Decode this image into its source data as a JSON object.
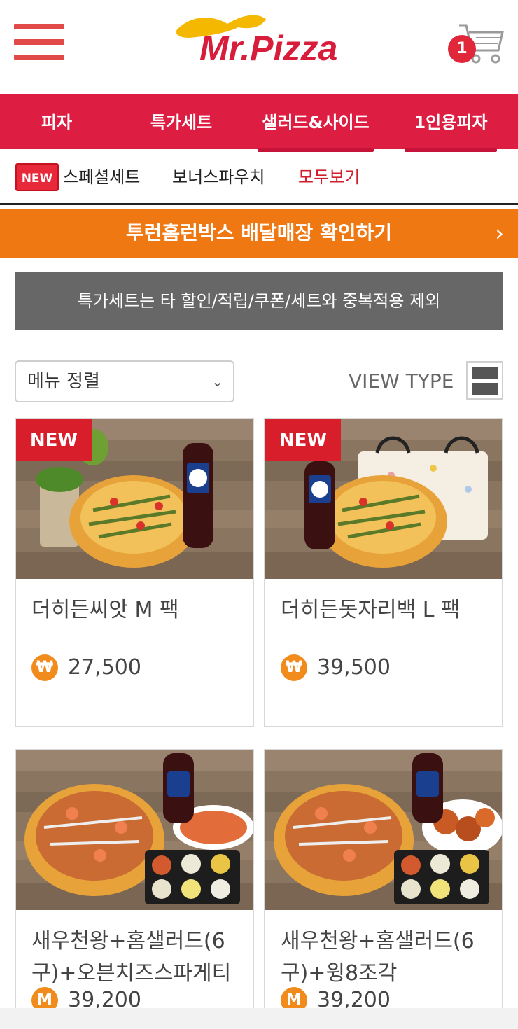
{
  "header": {
    "logo_text": "Mr.Pizza",
    "cart_count": "1"
  },
  "categories": [
    {
      "label": "피자"
    },
    {
      "label": "특가세트"
    },
    {
      "label": "샐러드&사이드"
    },
    {
      "label": "1인용피자"
    }
  ],
  "sub_nav": {
    "new_badge": "NEW",
    "items": [
      {
        "label": "스페셜세트"
      },
      {
        "label": "보너스파우치"
      },
      {
        "label": "모두보기"
      }
    ]
  },
  "banner": {
    "text": "투런홈런박스 배달매장 확인하기",
    "chevron": "›"
  },
  "notice": {
    "text": "특가세트는 타 할인/적립/쿠폰/세트와 중복적용 제외"
  },
  "sort": {
    "selected": "메뉴 정렬",
    "caret": "⌄"
  },
  "view_type": {
    "label": "VIEW TYPE"
  },
  "products": [
    {
      "tag": "NEW",
      "name": "더히든씨앗 M 팩",
      "currency": "₩",
      "price": "27,500"
    },
    {
      "tag": "NEW",
      "name": "더히든돗자리백 L 팩",
      "currency": "₩",
      "price": "39,500"
    },
    {
      "tag": "",
      "name_line1": "새우천왕+홈샐러드(6",
      "name_line2": "구)+오븐치즈스파게티",
      "currency": "M",
      "price": "39,200"
    },
    {
      "tag": "",
      "name_line1": "새우천왕+홈샐러드(6",
      "name_line2": "구)+윙8조각",
      "currency": "M",
      "price": "39,200"
    }
  ],
  "colors": {
    "brand_red": "#de1d42",
    "banner_orange": "#ef7812",
    "notice_grey": "#676767",
    "price_coin": "#f18b1c"
  }
}
